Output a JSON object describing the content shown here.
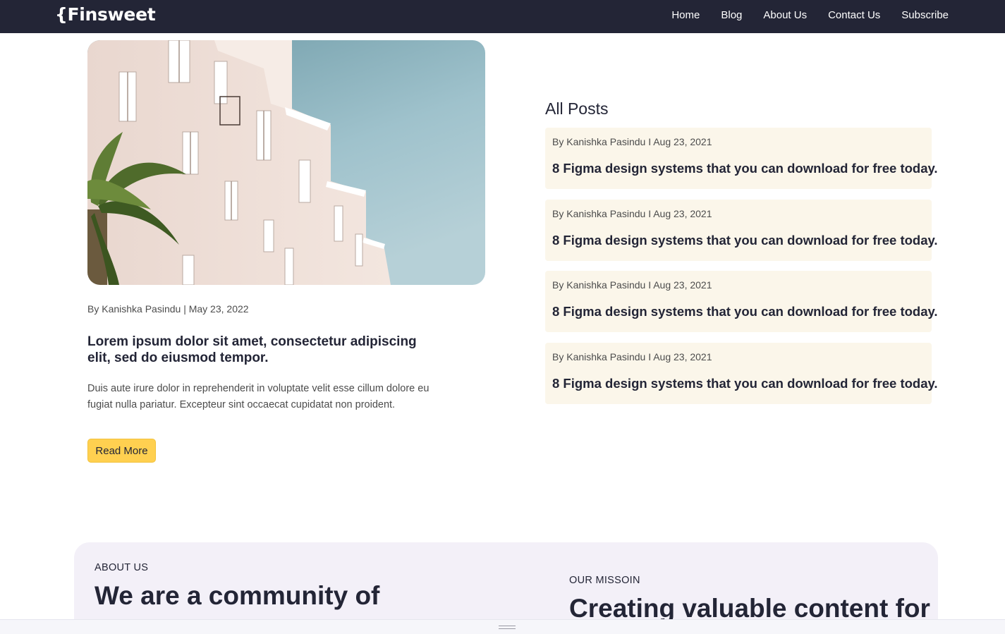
{
  "header": {
    "logo": "{Finsweet",
    "nav": [
      "Home",
      "Blog",
      "About Us",
      "Contact Us",
      "Subscribe"
    ]
  },
  "featured": {
    "meta": "By Kanishka Pasindu | May 23, 2022",
    "title": "Lorem ipsum dolor sit amet, consectetur adipiscing elit, sed do eiusmod tempor.",
    "excerpt": "Duis aute irure dolor in reprehenderit in voluptate velit esse cillum dolore eu fugiat nulla pariatur. Excepteur sint occaecat cupidatat non proident.",
    "read_more": "Read More"
  },
  "all_posts": {
    "heading": "All Posts",
    "posts": [
      {
        "meta": "By Kanishka Pasindu I Aug 23, 2021",
        "title": "8 Figma design systems that you can download for free today."
      },
      {
        "meta": "By Kanishka Pasindu I Aug 23, 2021",
        "title": "8 Figma design systems that you can download for free today."
      },
      {
        "meta": "By Kanishka Pasindu I Aug 23, 2021",
        "title": "8 Figma design systems that you can download for free today."
      },
      {
        "meta": "By Kanishka Pasindu I Aug 23, 2021",
        "title": "8 Figma design systems that you can download for free today."
      }
    ]
  },
  "about": {
    "label": "ABOUT US",
    "heading": "We are a community of",
    "mission_label": "OUR MISSOIN",
    "mission_heading": "Creating valuable content for"
  },
  "colors": {
    "navbar": "#232536",
    "accent": "#FFD050",
    "card_bg": "#FBF6EA",
    "about_bg": "#F3F0F8"
  }
}
